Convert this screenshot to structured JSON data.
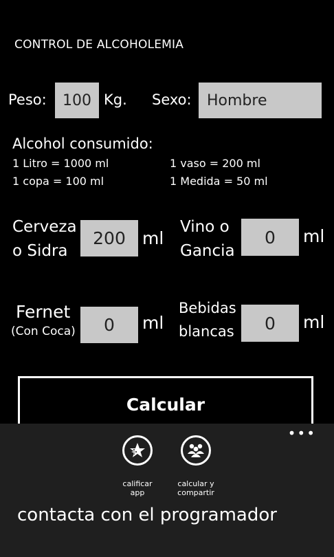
{
  "header": {
    "title": "CONTROL DE ALCOHOLEMIA"
  },
  "peso": {
    "label": "Peso:",
    "value": "100",
    "unit": "Kg."
  },
  "sexo": {
    "label": "Sexo:",
    "value": "Hombre"
  },
  "alcohol": {
    "title": "Alcohol consumido:",
    "conversions": [
      "1 Litro = 1000 ml",
      "1 vaso = 200 ml",
      "1 copa = 100 ml",
      "1 Medida = 50 ml"
    ]
  },
  "drinks": {
    "cerveza": {
      "line1": "Cerveza",
      "line2": "o Sidra",
      "value": "200",
      "unit": "ml"
    },
    "vino": {
      "line1": "Vino o",
      "line2": "Gancia",
      "value": "0",
      "unit": "ml"
    },
    "fernet": {
      "line1": "Fernet",
      "line2": "(Con Coca)",
      "value": "0",
      "unit": "ml"
    },
    "bebidas": {
      "line1": "Bebidas",
      "line2": "blancas",
      "value": "0",
      "unit": "ml"
    }
  },
  "calcular": {
    "label": "Calcular"
  },
  "appbar": {
    "more": "•••",
    "buttons": [
      {
        "label_line1": "calificar",
        "label_line2": "app",
        "icon": "star-plus-icon"
      },
      {
        "label_line1": "calcular y",
        "label_line2": "compartir",
        "icon": "people-icon"
      }
    ],
    "menu_item": "contacta con el programador"
  }
}
